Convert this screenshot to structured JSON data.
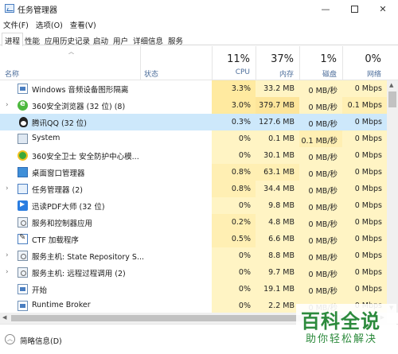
{
  "window": {
    "title": "任务管理器"
  },
  "menu": [
    "文件(F)",
    "选项(O)",
    "查看(V)"
  ],
  "tabs": [
    "进程",
    "性能",
    "应用历史记录",
    "启动",
    "用户",
    "详细信息",
    "服务"
  ],
  "active_tab": "进程",
  "columns": {
    "name": "名称",
    "status": "状态",
    "cpu": {
      "percent": "11%",
      "label": "CPU"
    },
    "memory": {
      "percent": "37%",
      "label": "内存"
    },
    "disk": {
      "percent": "1%",
      "label": "磁盘"
    },
    "network": {
      "percent": "0%",
      "label": "网络"
    }
  },
  "processes": [
    {
      "name": "Windows 音频设备图形隔离",
      "icon": "window-icon",
      "expandable": false,
      "cpu": "3.3%",
      "memory": "33.2 MB",
      "disk": "0 MB/秒",
      "network": "0 Mbps"
    },
    {
      "name": "360安全浏览器 (32 位) (8)",
      "icon": "360-browser-icon",
      "expandable": true,
      "cpu": "3.0%",
      "memory": "379.7 MB",
      "disk": "0 MB/秒",
      "network": "0.1 Mbps"
    },
    {
      "name": "腾讯QQ (32 位)",
      "icon": "qq-penguin-icon",
      "expandable": false,
      "selected": true,
      "cpu": "0.3%",
      "memory": "127.6 MB",
      "disk": "0 MB/秒",
      "network": "0 Mbps"
    },
    {
      "name": "System",
      "icon": "system-icon",
      "expandable": false,
      "cpu": "0%",
      "memory": "0.1 MB",
      "disk": "0.1 MB/秒",
      "network": "0 Mbps"
    },
    {
      "name": "360安全卫士 安全防护中心模...",
      "icon": "360-safe-icon",
      "expandable": false,
      "cpu": "0%",
      "memory": "30.1 MB",
      "disk": "0 MB/秒",
      "network": "0 Mbps"
    },
    {
      "name": "桌面窗口管理器",
      "icon": "desktop-window-icon",
      "expandable": false,
      "cpu": "0.8%",
      "memory": "63.1 MB",
      "disk": "0 MB/秒",
      "network": "0 Mbps"
    },
    {
      "name": "任务管理器 (2)",
      "icon": "task-manager-icon",
      "expandable": true,
      "cpu": "0.8%",
      "memory": "34.4 MB",
      "disk": "0 MB/秒",
      "network": "0 Mbps"
    },
    {
      "name": "迅读PDF大师 (32 位)",
      "icon": "pdf-reader-icon",
      "expandable": false,
      "cpu": "0%",
      "memory": "9.8 MB",
      "disk": "0 MB/秒",
      "network": "0 Mbps"
    },
    {
      "name": "服务和控制器应用",
      "icon": "service-icon",
      "expandable": false,
      "cpu": "0.2%",
      "memory": "4.8 MB",
      "disk": "0 MB/秒",
      "network": "0 Mbps"
    },
    {
      "name": "CTF 加载程序",
      "icon": "ctf-loader-icon",
      "expandable": false,
      "cpu": "0.5%",
      "memory": "6.6 MB",
      "disk": "0 MB/秒",
      "network": "0 Mbps"
    },
    {
      "name": "服务主机: State Repository S...",
      "icon": "service-icon",
      "expandable": true,
      "cpu": "0%",
      "memory": "8.8 MB",
      "disk": "0 MB/秒",
      "network": "0 Mbps"
    },
    {
      "name": "服务主机: 远程过程调用 (2)",
      "icon": "service-icon",
      "expandable": true,
      "cpu": "0%",
      "memory": "9.7 MB",
      "disk": "0 MB/秒",
      "network": "0 Mbps"
    },
    {
      "name": "开始",
      "icon": "window-icon",
      "expandable": false,
      "cpu": "0%",
      "memory": "19.1 MB",
      "disk": "0 MB/秒",
      "network": "0 Mbps"
    },
    {
      "name": "Runtime Broker",
      "icon": "window-icon",
      "expandable": false,
      "cpu": "0%",
      "memory": "2.2 MB",
      "disk": "0 MB/秒",
      "network": "0 Mbps"
    }
  ],
  "footer": {
    "less_details": "简略信息(D)"
  },
  "watermark": {
    "main": "百科全说",
    "sub": "助你轻松解决"
  },
  "colors": {
    "selected_row": "#cde8fb",
    "heat_light": "#fff4c4",
    "heat_mid": "#ffefb3",
    "heat_strong": "#ffeaa0",
    "watermark": "#2c8a3c"
  }
}
